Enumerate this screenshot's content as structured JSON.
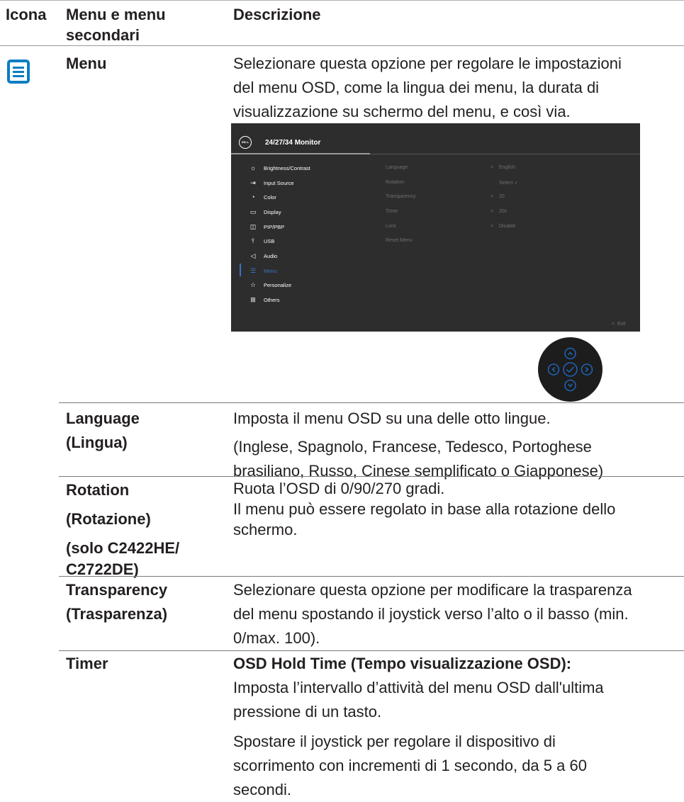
{
  "table": {
    "headers": {
      "icon": "Icona",
      "menu": [
        "Menu e menu",
        "secondari"
      ],
      "desc": "Descrizione"
    },
    "menu_row": {
      "label": "Menu",
      "desc": [
        "Selezionare questa opzione per regolare le impostazioni",
        "del menu OSD, come la lingua dei menu, la durata di",
        "visualizzazione su schermo del menu, e così via."
      ]
    },
    "rows": [
      {
        "label": [
          "Language",
          "(Lingua)"
        ],
        "desc": [
          "Imposta il menu OSD su una delle otto lingue.",
          "(Inglese, Spagnolo, Francese, Tedesco, Portoghese",
          "brasiliano, Russo, Cinese semplificato o Giapponese)"
        ]
      },
      {
        "label": [
          "Rotation",
          "(Rotazione)",
          "(solo C2422HE/",
          "C2722DE)"
        ],
        "desc": [
          "Ruota l’OSD di 0/90/270 gradi.",
          "Il menu può essere regolato in base alla rotazione dello",
          "schermo."
        ]
      },
      {
        "label": [
          "Transparency",
          "(Trasparenza)"
        ],
        "desc": [
          "Selezionare questa opzione per modificare la trasparenza",
          "del menu spostando il joystick verso l’alto o il basso (min.",
          "0/max. 100)."
        ]
      },
      {
        "label": [
          "Timer"
        ],
        "desc_bold": "OSD Hold Time (Tempo visualizzazione OSD):",
        "desc": [
          "Imposta l’intervallo d’attività del menu OSD dall'ultima",
          "pressione di un tasto.",
          "Spostare il joystick per regolare il dispositivo di",
          "scorrimento con incrementi di 1 secondo, da 5 a 60",
          "secondi."
        ]
      }
    ]
  },
  "osd": {
    "logo": "DELL",
    "title": "24/27/34 Monitor",
    "menu_items": [
      "Brightness/Contrast",
      "Input Source",
      "Color",
      "Display",
      "PIP/PBP",
      "USB",
      "Audio",
      "Menu",
      "Personalize",
      "Others"
    ],
    "menu_icons": [
      "brightness-icon",
      "input-source-icon",
      "color-icon",
      "display-icon",
      "pip-pbp-icon",
      "usb-icon",
      "audio-icon",
      "menu-icon",
      "personalize-icon",
      "others-icon"
    ],
    "selected_item": "Menu",
    "options": [
      {
        "label": "Language",
        "chevron": ">",
        "value": "English"
      },
      {
        "label": "Rotation",
        "chevron": "",
        "value": "Select ✓"
      },
      {
        "label": "Transparency",
        "chevron": ">",
        "value": "20"
      },
      {
        "label": "Timer",
        "chevron": ">",
        "value": "20s"
      },
      {
        "label": "Lock",
        "chevron": ">",
        "value": "Disable"
      },
      {
        "label": "Reset Menu",
        "chevron": "",
        "value": ""
      }
    ],
    "exit_chevron": "<",
    "exit_label": "Exit"
  },
  "colors": {
    "menu_icon_blue": "#0a7ec2",
    "osd_accent": "#3b74c6",
    "osd_bg": "#2d2d2d",
    "joystick_bg": "#1d1d1d",
    "joystick_accent": "#1f6fd1"
  }
}
